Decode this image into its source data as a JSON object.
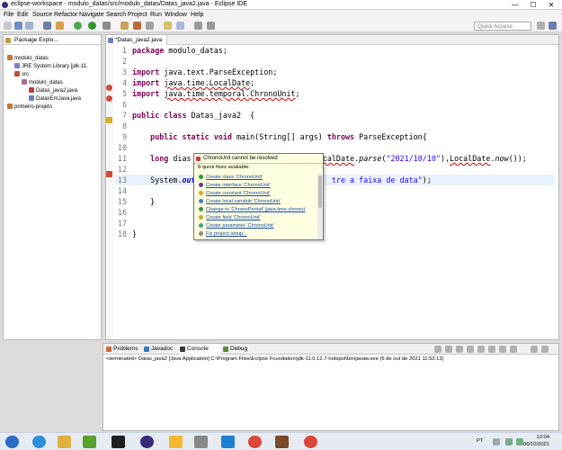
{
  "window": {
    "title": "eclipse-workspace - modulo_datas/src/modulo_datas/Datas_java2.java - Eclipse IDE",
    "minimize": "—",
    "maximize": "☐",
    "close": "✕"
  },
  "menu": [
    "File",
    "Edit",
    "Source",
    "Refactor",
    "Navigate",
    "Search",
    "Project",
    "Run",
    "Window",
    "Help"
  ],
  "toolbar": {
    "quick_access_placeholder": "Quick Access"
  },
  "package_explorer": {
    "tab_label": "Package Explo...",
    "tree": [
      {
        "label": "modulo_datas",
        "indent": 1
      },
      {
        "label": "JRE System Library [jdk-11.",
        "indent": 2
      },
      {
        "label": "src",
        "indent": 2
      },
      {
        "label": "modulo_datas",
        "indent": 3
      },
      {
        "label": "Datas_java2.java",
        "indent": 4
      },
      {
        "label": "DatasEmJava.java",
        "indent": 4
      },
      {
        "label": "primeiro-projeto",
        "indent": 1
      }
    ]
  },
  "editor": {
    "tab_label": "*Datas_java2.java",
    "line_numbers": [
      "1",
      "2",
      "3",
      "4",
      "5",
      "6",
      "7",
      "8",
      "9",
      "10",
      "11",
      "12",
      "13",
      "14",
      "15",
      "16",
      "17",
      "18"
    ]
  },
  "quick_fix": {
    "header": "ChronoUnit cannot be resolved",
    "subtitle": "8 quick fixes available:",
    "items": [
      "Create class 'ChronoUnit'",
      "Create interface 'ChronoUnit'",
      "Create constant 'ChronoUnit'",
      "Create local variable 'ChronoUnit'",
      "Change to 'ChronoPeriod' (java.time.chrono)",
      "Create field 'ChronoUnit'",
      "Create parameter 'ChronoUnit'",
      "Fix project setup..."
    ]
  },
  "bottom_panel": {
    "tabs": [
      "Problems",
      "Javadoc",
      "Console",
      "Debug"
    ],
    "console_text": "<terminated> Datas_java2 [Java Application] C:\\Program Files\\Eclipse Foundation\\jdk-11.0.12.7-hotspot\\bin\\javaw.exe (6 de out de 2021 11:53:13)"
  },
  "taskbar": {
    "lang": "PT",
    "time": "12:04",
    "date": "06/10/2021"
  },
  "colors": {
    "keyword": "#7f0055",
    "string": "#2a00ff",
    "static_field": "#0000c0",
    "error": "#d00000",
    "line_highlight": "#e8f2fe"
  }
}
